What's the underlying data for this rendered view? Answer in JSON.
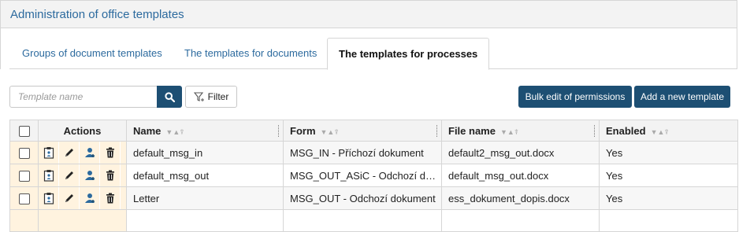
{
  "header": {
    "title": "Administration of office templates"
  },
  "tabs": [
    {
      "label": "Groups of document templates",
      "active": false
    },
    {
      "label": "The templates for documents",
      "active": false
    },
    {
      "label": "The templates for processes",
      "active": true
    }
  ],
  "toolbar": {
    "search_placeholder": "Template name",
    "filter_label": "Filter",
    "bulk_edit_label": "Bulk edit of permissions",
    "add_template_label": "Add a new template"
  },
  "table": {
    "columns": {
      "actions": "Actions",
      "name": "Name",
      "form": "Form",
      "file_name": "File name",
      "enabled": "Enabled"
    },
    "rows": [
      {
        "name": "default_msg_in",
        "form": "MSG_IN - Příchozí dokument",
        "file_name": "default2_msg_out.docx",
        "enabled": "Yes"
      },
      {
        "name": "default_msg_out",
        "form": "MSG_OUT_ASiC - Odchozí dokument",
        "file_name": "default_msg_out.docx",
        "enabled": "Yes"
      },
      {
        "name": "Letter",
        "form": "MSG_OUT - Odchozí dokument",
        "file_name": "ess_dokument_dopis.docx",
        "enabled": "Yes"
      }
    ]
  },
  "colors": {
    "accent": "#1d4f73",
    "link": "#2c6a9e",
    "row_action_bg": "#fff3df"
  }
}
